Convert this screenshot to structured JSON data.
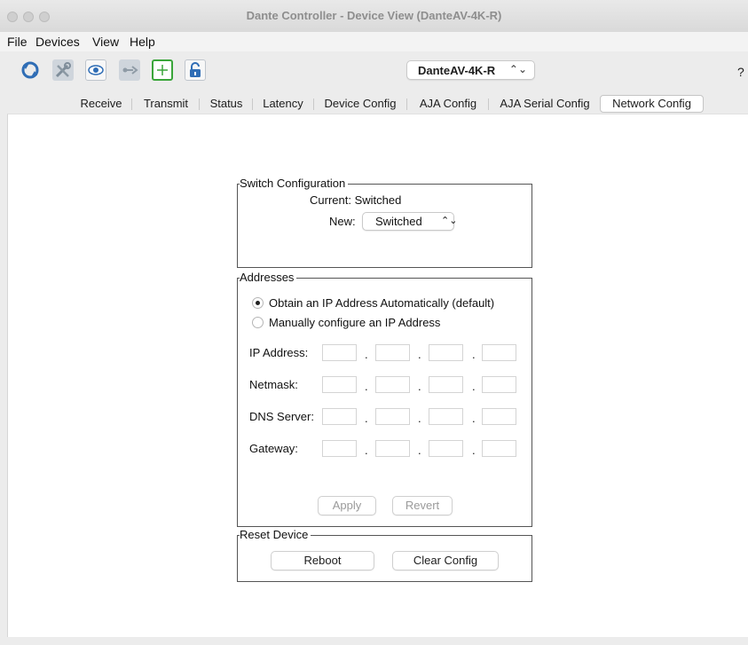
{
  "window": {
    "title": "Dante Controller - Device View (DanteAV-4K-R)"
  },
  "menu": [
    "File",
    "Devices",
    "View",
    "Help"
  ],
  "toolbar": {
    "icons": [
      "refresh-icon",
      "tools-icon",
      "eye-icon",
      "network-link-icon",
      "add-panel-icon",
      "lock-icon"
    ],
    "device_selected": "DanteAV-4K-R",
    "help_label": "?"
  },
  "tabs": [
    {
      "label": "Receive"
    },
    {
      "label": "Transmit"
    },
    {
      "label": "Status"
    },
    {
      "label": "Latency"
    },
    {
      "label": "Device Config"
    },
    {
      "label": "AJA Config"
    },
    {
      "label": "AJA Serial Config"
    },
    {
      "label": "Network Config",
      "active": true
    }
  ],
  "switch_config": {
    "legend": "Switch Configuration",
    "current_text": "Current: Switched",
    "new_label": "New:",
    "new_value": "Switched"
  },
  "addresses": {
    "legend": "Addresses",
    "option_auto": "Obtain an IP Address Automatically (default)",
    "option_manual": "Manually configure an IP Address",
    "auto_selected": true,
    "fields": [
      {
        "label": "IP Address:"
      },
      {
        "label": "Netmask:"
      },
      {
        "label": "DNS Server:"
      },
      {
        "label": "Gateway:"
      }
    ],
    "separator": ".",
    "apply_label": "Apply",
    "revert_label": "Revert"
  },
  "reset_device": {
    "legend": "Reset Device",
    "reboot_label": "Reboot",
    "clear_config_label": "Clear Config"
  },
  "colors": {
    "accent_green": "#3aa53a",
    "icon_blue": "#2f6db5"
  }
}
